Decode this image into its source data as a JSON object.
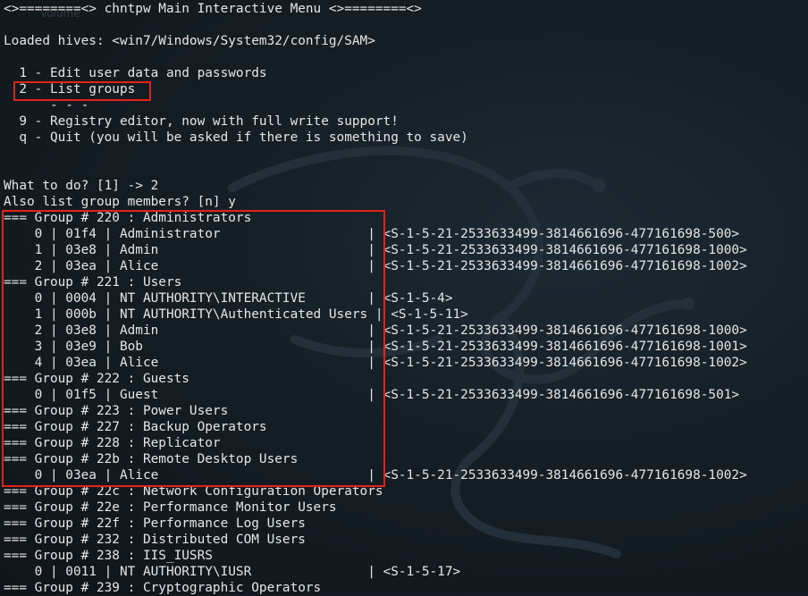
{
  "app": {
    "ghost_label": "Volume"
  },
  "menu": {
    "title": "<>========<> chntpw Main Interactive Menu <>========<>",
    "loaded_hives": "Loaded hives: <win7/Windows/System32/config/SAM>",
    "items": [
      {
        "key": "1",
        "text": "  1 - Edit user data and passwords"
      },
      {
        "key": "2",
        "text": "  2 - List groups"
      },
      {
        "key": "sep",
        "text": "      - - -"
      },
      {
        "key": "9",
        "text": "  9 - Registry editor, now with full write support!"
      },
      {
        "key": "q",
        "text": "  q - Quit (you will be asked if there is something to save)"
      }
    ]
  },
  "session": {
    "prompt": "What to do? [1] -> 2",
    "members_prompt": "Also list group members? [n] y"
  },
  "groups_output": [
    "=== Group # 220 : Administrators",
    "    0 | 01f4 | Administrator                   | <S-1-5-21-2533633499-3814661696-477161698-500>",
    "    1 | 03e8 | Admin                           | <S-1-5-21-2533633499-3814661696-477161698-1000>",
    "    2 | 03ea | Alice                           | <S-1-5-21-2533633499-3814661696-477161698-1002>",
    "=== Group # 221 : Users",
    "    0 | 0004 | NT AUTHORITY\\INTERACTIVE        | <S-1-5-4>",
    "    1 | 000b | NT AUTHORITY\\Authenticated Users | <S-1-5-11>",
    "    2 | 03e8 | Admin                           | <S-1-5-21-2533633499-3814661696-477161698-1000>",
    "    3 | 03e9 | Bob                             | <S-1-5-21-2533633499-3814661696-477161698-1001>",
    "    4 | 03ea | Alice                           | <S-1-5-21-2533633499-3814661696-477161698-1002>",
    "=== Group # 222 : Guests",
    "    0 | 01f5 | Guest                           | <S-1-5-21-2533633499-3814661696-477161698-501>",
    "=== Group # 223 : Power Users",
    "=== Group # 227 : Backup Operators",
    "=== Group # 228 : Replicator",
    "=== Group # 22b : Remote Desktop Users",
    "    0 | 03ea | Alice                           | <S-1-5-21-2533633499-3814661696-477161698-1002>",
    "=== Group # 22c : Network Configuration Operators",
    "=== Group # 22e : Performance Monitor Users",
    "=== Group # 22f : Performance Log Users",
    "=== Group # 232 : Distributed COM Users",
    "=== Group # 238 : IIS_IUSRS",
    "    0 | 0011 | NT AUTHORITY\\IUSR               | <S-1-5-17>",
    "=== Group # 239 : Cryptographic Operators"
  ],
  "colors": {
    "background": "#151e25",
    "text": "#e6e6e6",
    "highlight_box": "#e2231a"
  }
}
